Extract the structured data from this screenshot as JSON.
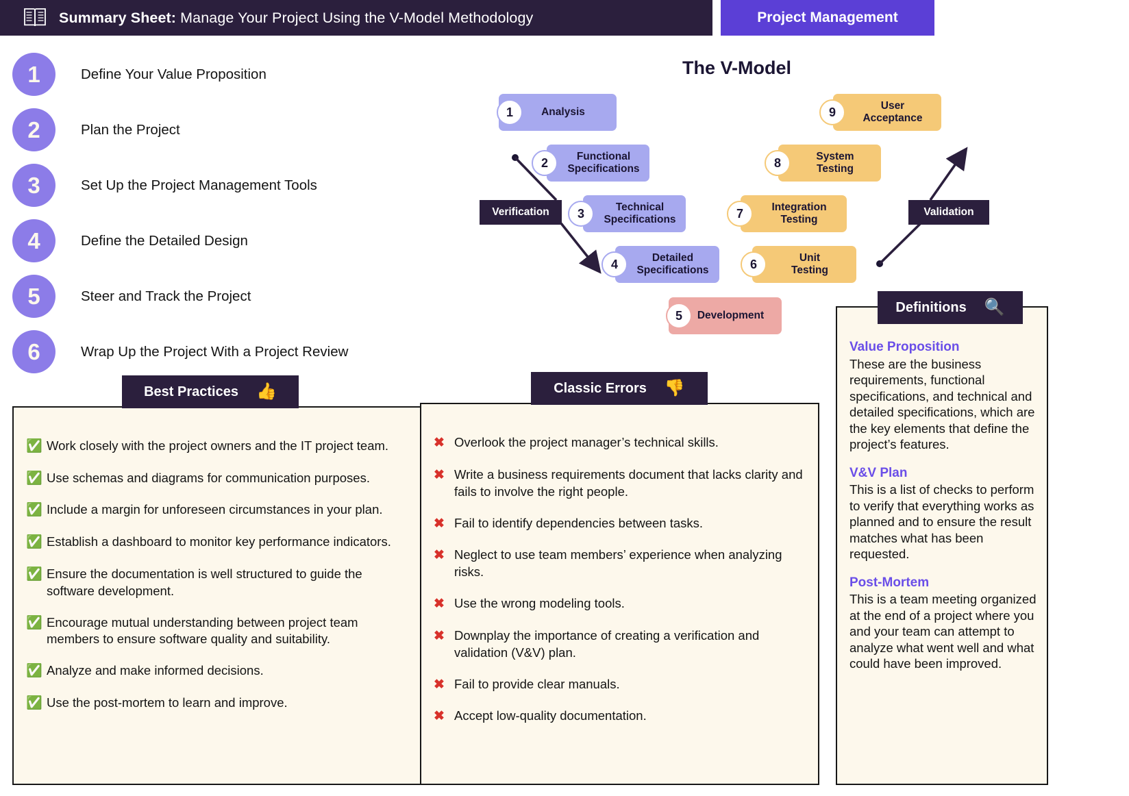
{
  "header": {
    "icon": "open-book-icon",
    "title_bold": "Summary Sheet:",
    "title_rest": " Manage Your Project Using the V-Model Methodology",
    "badge": "Project Management",
    "badge_color": "#5b3fd6",
    "bar_color": "#2b1f3d"
  },
  "steps": [
    {
      "num": "1",
      "label": "Define Your Value Proposition"
    },
    {
      "num": "2",
      "label": "Plan the Project"
    },
    {
      "num": "3",
      "label": "Set Up the Project Management Tools"
    },
    {
      "num": "4",
      "label": "Define the Detailed Design"
    },
    {
      "num": "5",
      "label": "Steer and Track the Project"
    },
    {
      "num": "6",
      "label": "Wrap Up the Project With a Project Review"
    }
  ],
  "vmodel": {
    "title": "The V-Model",
    "verification_label": "Verification",
    "validation_label": "Validation",
    "boxes": [
      {
        "num": "1",
        "label": "Analysis",
        "color": "blue"
      },
      {
        "num": "2",
        "label": "Functional\nSpecifications",
        "color": "blue"
      },
      {
        "num": "3",
        "label": "Technical\nSpecifications",
        "color": "blue"
      },
      {
        "num": "4",
        "label": "Detailed\nSpecifications",
        "color": "blue"
      },
      {
        "num": "5",
        "label": "Development",
        "color": "rose"
      },
      {
        "num": "6",
        "label": "Unit\nTesting",
        "color": "amber"
      },
      {
        "num": "7",
        "label": "Integration\nTesting",
        "color": "amber"
      },
      {
        "num": "8",
        "label": "System\nTesting",
        "color": "amber"
      },
      {
        "num": "9",
        "label": "User\nAcceptance",
        "color": "amber"
      }
    ],
    "colors": {
      "blue": "#a7a9ef",
      "amber": "#f5c977",
      "rose": "#eda9a5"
    }
  },
  "best_practices": {
    "title": "Best Practices",
    "icon": "thumbs-up-icon",
    "icon_glyph": "👍",
    "mark": "✅",
    "items": [
      "Work closely with the project owners and the IT project team.",
      "Use schemas and diagrams for communication purposes.",
      "Include a margin for unforeseen circumstances in your plan.",
      "Establish a dashboard to monitor key performance indicators.",
      "Ensure the documentation is well structured to guide the software development.",
      "Encourage mutual understanding between project team members to ensure software quality and suitability.",
      "Analyze and make informed decisions.",
      "Use the post-mortem to learn and improve."
    ]
  },
  "classic_errors": {
    "title": "Classic Errors",
    "icon": "thumbs-down-icon",
    "icon_glyph": "👎",
    "mark": "✖",
    "items": [
      "Overlook the project manager’s technical skills.",
      "Write a business requirements document that lacks clarity and fails to involve the right people.",
      "Fail to identify dependencies between tasks.",
      "Neglect to use team members’ experience when analyzing risks.",
      "Use the wrong modeling tools.",
      "Downplay the importance of creating a verification and validation (V&V) plan.",
      "Fail to provide clear manuals.",
      "Accept low-quality documentation."
    ]
  },
  "definitions": {
    "title": "Definitions",
    "icon": "magnifier-icon",
    "icon_glyph": "🔍",
    "entries": [
      {
        "term": "Value Proposition",
        "desc": "These are the business requirements, functional specifications, and technical and detailed specifications, which are the key elements that define the project’s features."
      },
      {
        "term": "V&V Plan",
        "desc": "This is a list of checks to perform to verify that everything works as planned and to ensure the result matches what has been requested."
      },
      {
        "term": "Post-Mortem",
        "desc": "This is a team meeting organized at the end of a project where you and your team can attempt to analyze what went well and what could have been improved."
      }
    ],
    "term_color": "#6a4ee8"
  }
}
